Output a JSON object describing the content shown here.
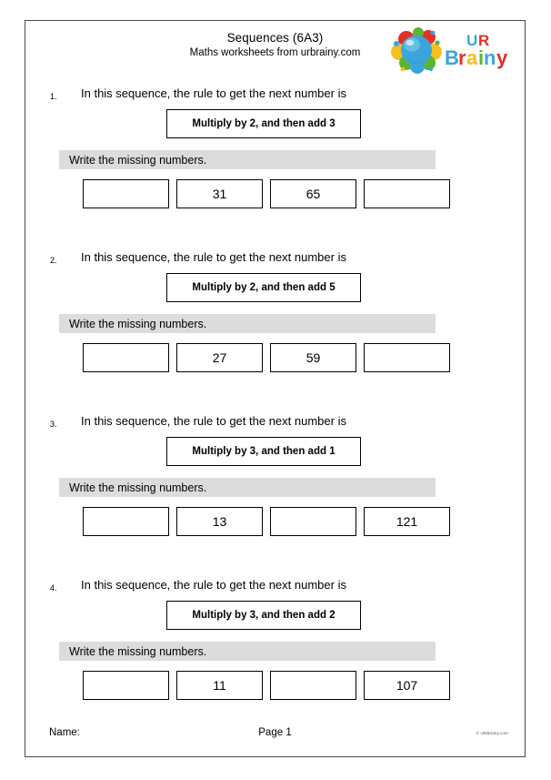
{
  "header": {
    "title": "Sequences (6A3)",
    "subtitle": "Maths worksheets from urbrainy.com",
    "logo": {
      "name": "urbrainy-logo",
      "text_line1": "UR",
      "text_line2": "Brainy",
      "colors": {
        "head_blue": "#3aa5dc",
        "splash_red": "#e03127",
        "splash_yellow": "#f5bf1f",
        "splash_green": "#5cb531",
        "letter_b": "#3aa5dc",
        "letter_r": "#e03127",
        "letter_a": "#f5bf1f",
        "letter_i": "#5cb531",
        "letter_n": "#3aa5dc",
        "letter_y": "#e03127",
        "letter_u": "#3aa5dc",
        "letter_r2": "#e03127"
      }
    }
  },
  "questions": [
    {
      "number": "1.",
      "prompt": "In this sequence, the rule to get the next number is",
      "rule": "Multiply by 2, and then add 3",
      "instruction": "Write the missing numbers.",
      "boxes": [
        "",
        "31",
        "65",
        ""
      ]
    },
    {
      "number": "2.",
      "prompt": "In this sequence, the rule to get the next number is",
      "rule": "Multiply by 2, and then add 5",
      "instruction": "Write the missing numbers.",
      "boxes": [
        "",
        "27",
        "59",
        ""
      ]
    },
    {
      "number": "3.",
      "prompt": "In this sequence, the rule to get the next number is",
      "rule": "Multiply by 3, and then add 1",
      "instruction": "Write the missing numbers.",
      "boxes": [
        "",
        "13",
        "",
        "121"
      ]
    },
    {
      "number": "4.",
      "prompt": "In this sequence, the rule to get the next number is",
      "rule": "Multiply by 3, and then add 2",
      "instruction": "Write the missing numbers.",
      "boxes": [
        "",
        "11",
        "",
        "107"
      ]
    }
  ],
  "footer": {
    "name_label": "Name:",
    "page_label": "Page 1",
    "copyright": "© URBrainy.com"
  },
  "colors": {
    "page_border": "#4a4a4a",
    "instruction_bar": "#dcdcdc",
    "box_border": "#000000",
    "text": "#000000"
  }
}
